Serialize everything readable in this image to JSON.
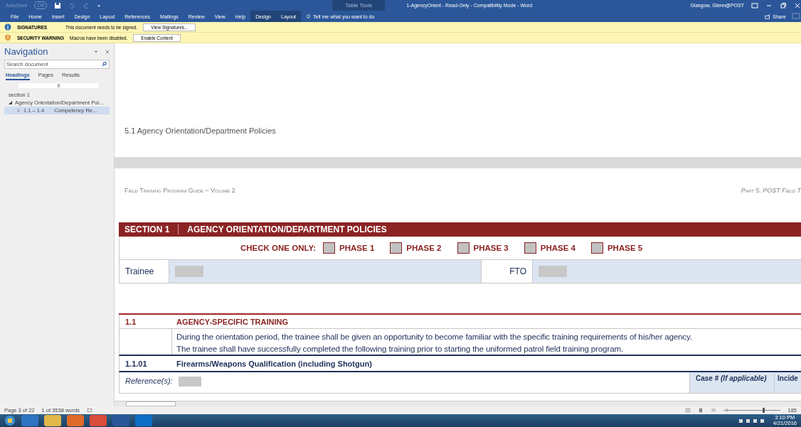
{
  "title_bar": {
    "autosave_label": "AutoSave",
    "autosave_state": "Off",
    "autosave_on": false,
    "contextual_group": "Table Tools",
    "title": "1-AgencyOrient  -  Read-Only  -  Compatibility Mode  -  Word",
    "user": "Glasgow, Glenn@POST"
  },
  "ribbon_tabs": [
    {
      "label": "File",
      "contextual": false
    },
    {
      "label": "Home",
      "contextual": false
    },
    {
      "label": "Insert",
      "contextual": false
    },
    {
      "label": "Design",
      "contextual": false
    },
    {
      "label": "Layout",
      "contextual": false
    },
    {
      "label": "References",
      "contextual": false
    },
    {
      "label": "Mailings",
      "contextual": false
    },
    {
      "label": "Review",
      "contextual": false
    },
    {
      "label": "View",
      "contextual": false
    },
    {
      "label": "Help",
      "contextual": false
    },
    {
      "label": "Design",
      "contextual": true
    },
    {
      "label": "Layout",
      "contextual": true
    }
  ],
  "tell_me": "Tell me what you want to do",
  "share": "Share",
  "message_bars": [
    {
      "kind": "info",
      "title": "SIGNATURES",
      "text": "This document needs to be signed.",
      "button": "View Signatures..."
    },
    {
      "kind": "warning",
      "title": "SECURITY WARNING",
      "text": "Macros have been disabled.",
      "button": "Enable Content"
    }
  ],
  "navigation": {
    "title": "Navigation",
    "search": {
      "placeholder": "Search document"
    },
    "tabs": [
      {
        "label": "Headings",
        "selected": true
      },
      {
        "label": "Pages",
        "selected": false
      },
      {
        "label": "Results",
        "selected": false
      }
    ],
    "tree": [
      {
        "label": "section 1",
        "selected": false
      },
      {
        "label": "Agency Orientation/Department Pol...",
        "expanded": true,
        "selected": false,
        "children": [
          {
            "number": "1.1 – 1.4",
            "label": "Competency Re...",
            "expanded": false,
            "selected": true
          }
        ]
      }
    ]
  },
  "document": {
    "page_heading": "5.1 Agency Orientation/Department Policies",
    "header_left": "Field Training Program Guide – Volume 2",
    "header_right": "Part 5.  POST Field T",
    "section": {
      "number": "SECTION 1",
      "title": "AGENCY ORIENTATION/DEPARTMENT POLICIES",
      "check_label": "CHECK ONE ONLY:",
      "phases": [
        {
          "label": "PHASE 1",
          "checked": false
        },
        {
          "label": "PHASE 2",
          "checked": false
        },
        {
          "label": "PHASE 3",
          "checked": false
        },
        {
          "label": "PHASE 4",
          "checked": false
        },
        {
          "label": "PHASE 5",
          "checked": false
        }
      ],
      "trainee_label": "Trainee",
      "fto_label": "FTO"
    },
    "subsection": {
      "number": "1.1",
      "title": "AGENCY-SPECIFIC TRAINING",
      "description": [
        "During the orientation period, the trainee shall be given an opportunity to become familiar with the specific training requirements of his/her agency.",
        "The trainee shall have successfully completed the following training prior to starting the uniformed patrol field training program."
      ],
      "item_number": "1.1.01",
      "item_title": "Firearms/Weapons Qualification (including Shotgun)",
      "reference_label": "Reference(s):",
      "case_label": "Case # *(If applicable)*",
      "incident_label": "Incide"
    }
  },
  "status_bar": {
    "page": "Page 3 of 22",
    "words": "1 of 3538 words",
    "zoom": "185"
  },
  "taskbar": {
    "clock_time": "3:10 PM",
    "clock_date": "4/21/2016"
  }
}
